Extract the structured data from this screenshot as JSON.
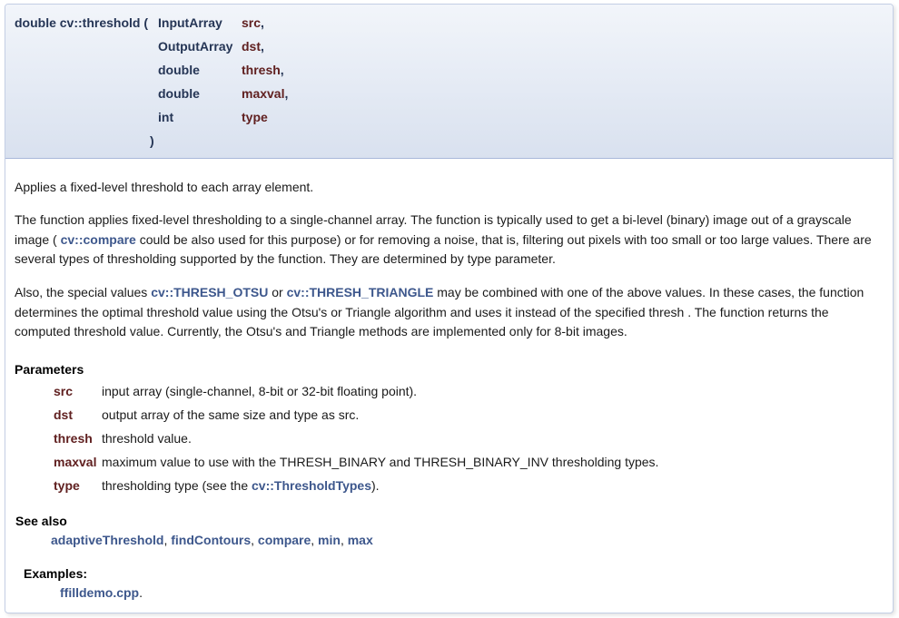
{
  "prototype": {
    "return_and_name": "double cv::threshold (",
    "params": [
      {
        "type": "InputArray",
        "name": "src",
        "sep": ","
      },
      {
        "type": "OutputArray",
        "name": "dst",
        "sep": ","
      },
      {
        "type": "double",
        "name": "thresh",
        "sep": ","
      },
      {
        "type": "double",
        "name": "maxval",
        "sep": ","
      },
      {
        "type": "int",
        "name": "type",
        "sep": ""
      }
    ],
    "close": ")"
  },
  "brief": "Applies a fixed-level threshold to each array element.",
  "para1": {
    "t1": "The function applies fixed-level thresholding to a single-channel array. The function is typically used to get a bi-level (binary) image out of a grayscale image ( ",
    "link": "cv::compare",
    "t2": " could be also used for this purpose) or for removing a noise, that is, filtering out pixels with too small or too large values. There are several types of thresholding supported by the function. They are determined by type parameter."
  },
  "para2": {
    "t1": "Also, the special values ",
    "link1": "cv::THRESH_OTSU",
    "t2": " or ",
    "link2": "cv::THRESH_TRIANGLE",
    "t3": " may be combined with one of the above values. In these cases, the function determines the optimal threshold value using the Otsu's or Triangle algorithm and uses it instead of the specified thresh . The function returns the computed threshold value. Currently, the Otsu's and Triangle methods are implemented only for 8-bit images."
  },
  "parameters": {
    "heading": "Parameters",
    "items": [
      {
        "name": "src",
        "desc": "input array (single-channel, 8-bit or 32-bit floating point)."
      },
      {
        "name": "dst",
        "desc": "output array of the same size and type as src."
      },
      {
        "name": "thresh",
        "desc": "threshold value."
      },
      {
        "name": "maxval",
        "desc": "maximum value to use with the THRESH_BINARY and THRESH_BINARY_INV thresholding types."
      },
      {
        "name": "type",
        "desc_pre": "thresholding type (see the ",
        "link": "cv::ThresholdTypes",
        "desc_post": ")."
      }
    ]
  },
  "see_also": {
    "heading": "See also",
    "links": [
      "adaptiveThreshold",
      "findContours",
      "compare",
      "min",
      "max"
    ],
    "sep": ", "
  },
  "examples": {
    "heading": "Examples:",
    "link": "ffilldemo.cpp",
    "suffix": "."
  }
}
